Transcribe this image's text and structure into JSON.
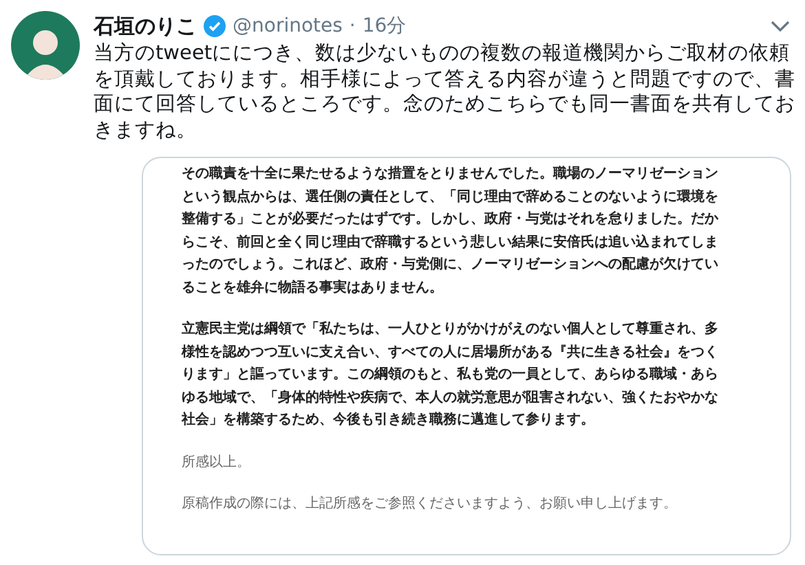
{
  "tweet": {
    "author": "石垣のりこ",
    "handle": "@norinotes",
    "separator": "·",
    "time": "16分",
    "text": "当方のtweetににつき、数は少ないものの複数の報道機関からご取材の依頼を頂戴しております。相手様によって答える内容が違うと問題ですので、書面にて回答しているところです。念のためこちらでも同一書面を共有しておきますね。",
    "document": {
      "paragraphs": [
        {
          "text": "その職責を十全に果たせるような措置をとりませんでした。職場のノーマリゼーションという観点からは、選任側の責任として、「同じ理由で辞めることのないように環境を整備する」ことが必要だったはずです。しかし、政府・与党はそれを怠りました。だからこそ、前回と全く同じ理由で辞職するという悲しい結果に安倍氏は追い込まれてしまったのでしょう。これほど、政府・与党側に、ノーマリゼーションへの配慮が欠けていることを雄弁に物語る事実はありません。",
          "bold": true
        },
        {
          "text": "立憲民主党は綱領で「私たちは、一人ひとりがかけがえのない個人として尊重され、多様性を認めつつ互いに支え合い、すべての人に居場所がある『共に生きる社会』をつくります」と謳っています。この綱領のもと、私も党の一員として、あらゆる職域・あらゆる地域で、「身体的特性や疾病で、本人の就労意思が阻害されない、強くたおやかな社会」を構築するため、今後も引き続き職務に邁進して参ります。",
          "bold": true
        },
        {
          "text": "所感以上。",
          "bold": false
        },
        {
          "text": "原稿作成の際には、上記所感をご参照くださいますよう、お願い申し上げます。",
          "bold": false
        }
      ]
    }
  }
}
